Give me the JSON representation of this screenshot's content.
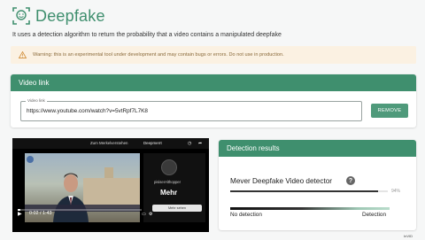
{
  "header": {
    "title": "Deepfake",
    "icon": "face-scan-icon"
  },
  "subtitle": "It uses a detection algorithm to return the probability that a video contains a manipulated deepfake",
  "warning": {
    "icon": "warning-icon",
    "text": "Warning: this is an experimental tool under development and may contain bugs or errors. Do not use in production."
  },
  "video_link": {
    "panel_title": "Video link",
    "field_label": "Video link",
    "value": "https://www.youtube.com/watch?v=5vtRpf7L7K8",
    "remove_label": "REMOVE"
  },
  "video_player": {
    "top_title": "Zum Merkelverstehen",
    "top_title2": "Deepmerrt",
    "channel_name": "pisiserAlthopper",
    "side_label": "Mehr",
    "side_button": "Mehr sehen",
    "time": "0:02 / 1:43",
    "progress": 0.02
  },
  "results": {
    "panel_title": "Detection results",
    "detector_name": "Mever Deepfake Video detector",
    "score_pct": "94%",
    "score_value": 0.94,
    "scale_left": "No detection",
    "scale_right": "Detection"
  },
  "footer": {
    "badge": "InVID"
  },
  "colors": {
    "brand": "#3f8f6e",
    "button": "#4f9a7b",
    "warning_bg": "#fbf1e2"
  }
}
